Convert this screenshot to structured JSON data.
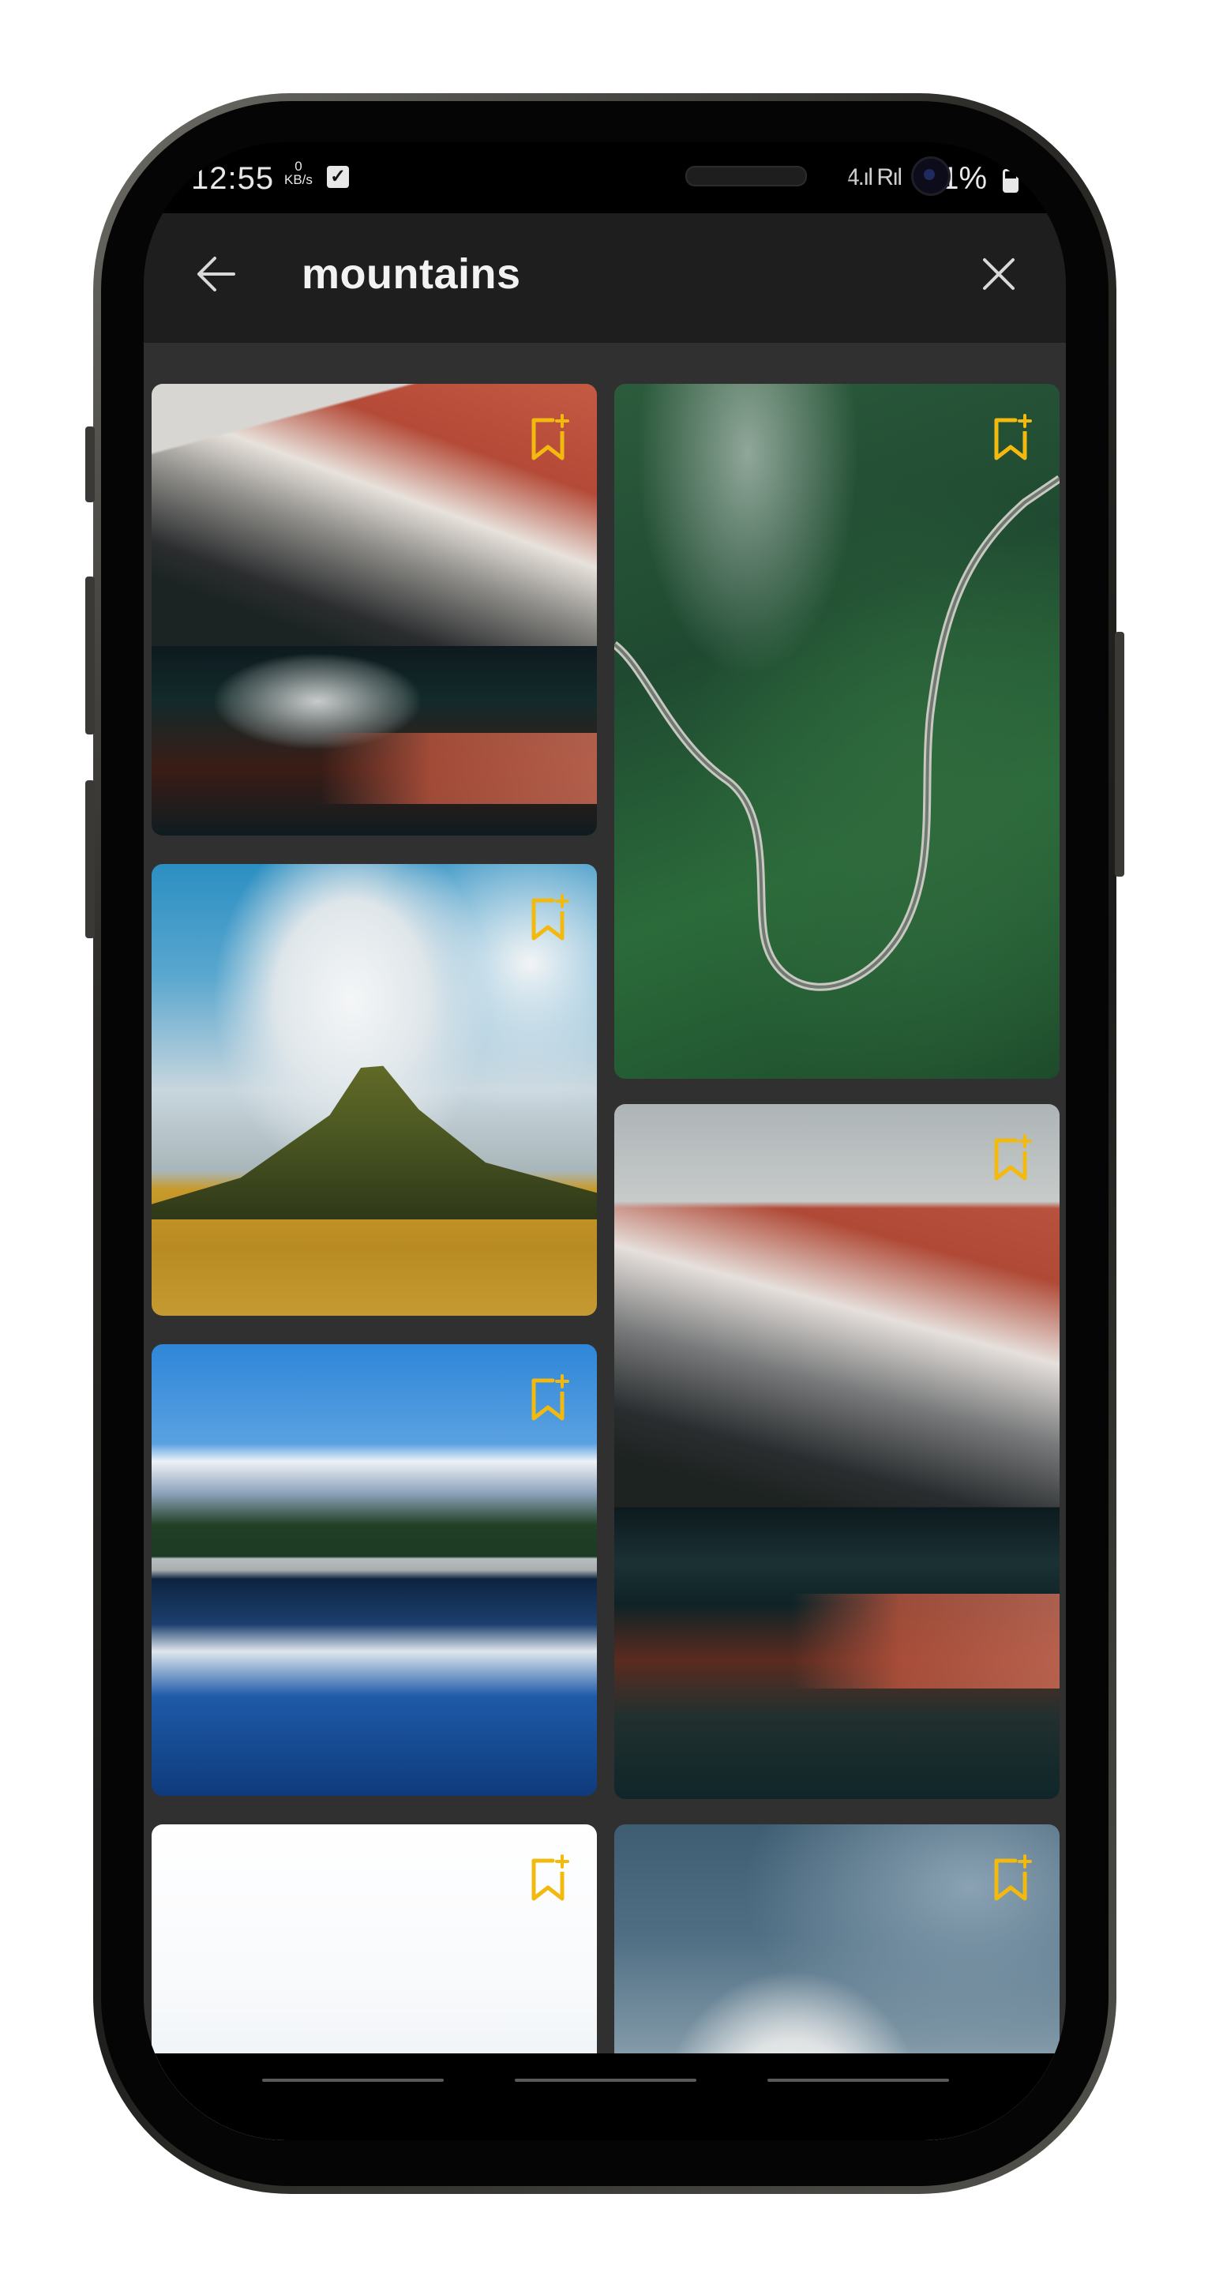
{
  "status_bar": {
    "time": "12:55",
    "net_speed_value": "0",
    "net_speed_unit": "KB/s",
    "signal": "4.ıl Rıl",
    "battery_percent": "61%"
  },
  "app_bar": {
    "query": "mountains",
    "back_icon": "arrow-left-icon",
    "close_icon": "close-icon"
  },
  "results": [
    {
      "column": 1,
      "subject": "moraine-lake-reflection",
      "bookmark_icon": "bookmark-add-icon"
    },
    {
      "column": 2,
      "subject": "winding-green-mountain-road",
      "bookmark_icon": "bookmark-add-icon"
    },
    {
      "column": 1,
      "subject": "kirkjufell-grass-peak",
      "bookmark_icon": "bookmark-add-icon"
    },
    {
      "column": 2,
      "subject": "moraine-lake-reflection",
      "bookmark_icon": "bookmark-add-icon"
    },
    {
      "column": 1,
      "subject": "snowy-alps-lake-reflection",
      "bookmark_icon": "bookmark-add-icon"
    },
    {
      "column": 1,
      "subject": "white-cloudy-sky",
      "bookmark_icon": "bookmark-add-icon"
    },
    {
      "column": 2,
      "subject": "cloud-covered-snow-peak",
      "bookmark_icon": "bookmark-add-icon"
    }
  ],
  "colors": {
    "app_bar_bg": "#1e1e1e",
    "content_bg": "#303030",
    "bookmark_accent": "#f2b90f",
    "title_text": "#f2f2f2"
  }
}
